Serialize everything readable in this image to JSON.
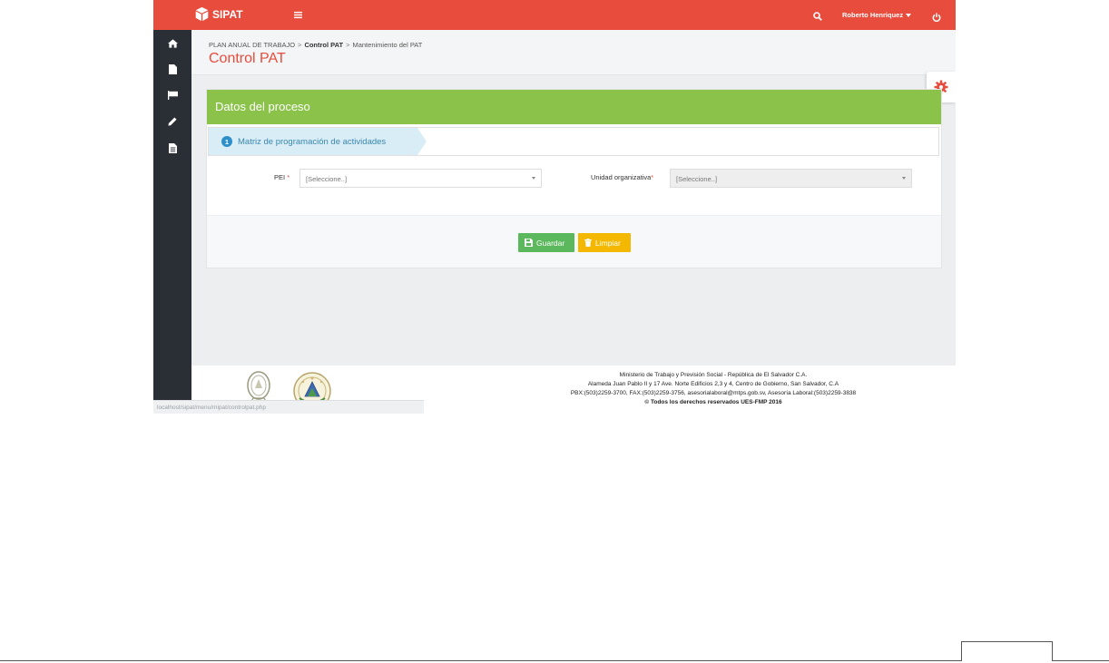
{
  "app": {
    "brand": "SIPAT"
  },
  "topbar": {
    "user": "Roberto Henriquez",
    "icons": [
      "menu-icon",
      "search-icon",
      "power-icon"
    ]
  },
  "sidebar": {
    "items": [
      {
        "icon": "home-icon"
      },
      {
        "icon": "file-icon"
      },
      {
        "icon": "flag-icon"
      },
      {
        "icon": "pencil-icon"
      },
      {
        "icon": "document-list-icon"
      }
    ]
  },
  "breadcrumb": {
    "items": [
      "PLAN ANUAL DE TRABAJO",
      "Control PAT",
      "Mantenimiento del PAT"
    ]
  },
  "page": {
    "title": "Control PAT"
  },
  "panel": {
    "title": "Datos del proceso",
    "step": {
      "number": "1",
      "label": "Matriz de programación de actividades"
    },
    "fields": {
      "pei": {
        "label": "PEI",
        "required": "*",
        "value": "[Seleccione..]"
      },
      "unidad": {
        "label": "Unidad organizativa",
        "required": "*",
        "value": "[Seleccione..]"
      }
    },
    "buttons": {
      "save": "Guardar",
      "clear": "Limpiar"
    }
  },
  "footer": {
    "line1": "Ministerio de Trabajo y Previsión Social - República de El Salvador C.A.",
    "line2": "Alameda Juan Pablo II y 17 Ave. Norte Edificios 2,3 y 4, Centro de Gobierno, San Salvador, C.A",
    "line3": "PBX:(503)2259-3700, FAX:(503)2259-3756, asesorialaboral@mtps.gob.sv, Asesoría Laboral:(503)2259-3838",
    "line4": "© Todos los derechos reservados UES-FMP 2016"
  },
  "statusbar": {
    "url": "localhost/sipat/menu/mipat/controlpat.php"
  },
  "colors": {
    "header": "#e84c3d",
    "panel_head": "#8bc34a",
    "save": "#5cb85c",
    "clear": "#f5b800",
    "sidebar": "#2a2f35"
  }
}
